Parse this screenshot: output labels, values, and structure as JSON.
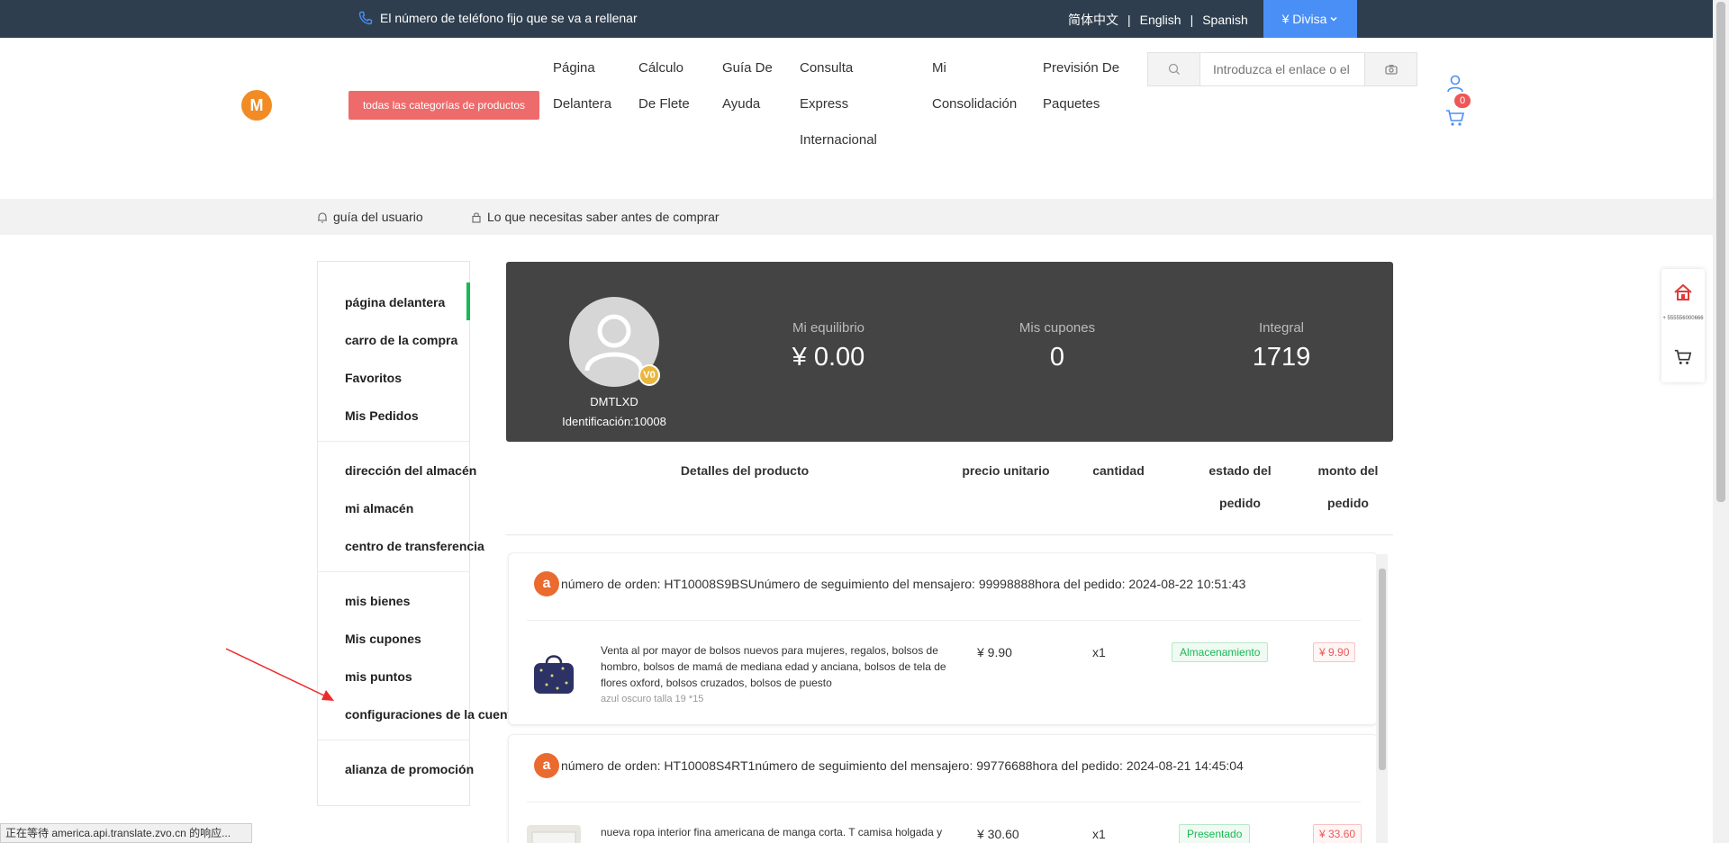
{
  "topbar": {
    "phone_text": "El número de teléfono fijo que se va a rellenar",
    "langs": [
      "简体中文",
      "English",
      "Spanish"
    ],
    "currency": "¥ Divisa"
  },
  "header": {
    "category_button": "todas las categorías de productos",
    "nav": [
      {
        "lines": [
          "Página",
          "Delantera"
        ]
      },
      {
        "lines": [
          "Cálculo",
          "De Flete"
        ]
      },
      {
        "lines": [
          "Guía De",
          "Ayuda"
        ]
      },
      {
        "lines": [
          "Consulta",
          "Express",
          "Internacional"
        ]
      },
      {
        "lines": [
          "Mi",
          "Consolidación"
        ]
      },
      {
        "lines": [
          "Previsión De",
          "Paquetes"
        ]
      }
    ],
    "search_placeholder": "Introduzca el enlace o el",
    "cart_count": "0"
  },
  "guide": {
    "user_guide": "guía del usuario",
    "before_buy": "Lo que necesitas saber antes de comprar"
  },
  "sidebar": {
    "items": [
      "página delantera",
      "carro de la compra",
      "Favoritos",
      "Mis Pedidos",
      "dirección del almacén",
      "mi almacén",
      "centro de transferencia",
      "mis bienes",
      "Mis cupones",
      "mis puntos",
      "configuraciones de la cuenta",
      "alianza de promoción"
    ]
  },
  "profile": {
    "level": "V0",
    "username": "DMTLXD",
    "id_text": "Identificación:10008",
    "balance_label": "Mi equilibrio",
    "balance_value": "¥ 0.00",
    "coupons_label": "Mis cupones",
    "coupons_value": "0",
    "integral_label": "Integral",
    "integral_value": "1719"
  },
  "table": {
    "col_details": "Detalles del producto",
    "col_unit_price": "precio unitario",
    "col_quantity": "cantidad",
    "col_status": [
      "estado del",
      "pedido"
    ],
    "col_amount": [
      "monto del",
      "pedido"
    ]
  },
  "orders": [
    {
      "header": "número de orden: HT10008S9BSUnúmero de seguimiento del mensajero: 99998888hora del pedido: 2024-08-22 10:51:43",
      "title": "Venta al por mayor de bolsos nuevos para mujeres, regalos, bolsos de hombro, bolsos de mamá de mediana edad y anciana, bolsos de tela de flores oxford, bolsos cruzados, bolsos de puesto",
      "sku": "azul oscuro talla 19 *15",
      "price": "¥ 9.90",
      "qty": "x1",
      "status": "Almacenamiento",
      "amount": "¥ 9.90"
    },
    {
      "header": "número de orden: HT10008S4RT1número de seguimiento del mensajero: 99776688hora del pedido: 2024-08-21 14:45:04",
      "title": "nueva ropa interior fina americana de manga corta. T camisa holgada y",
      "sku": "",
      "price": "¥ 30.60",
      "qty": "x1",
      "status": "Presentado",
      "amount": "¥ 33.60"
    }
  ],
  "float_panel": {
    "mini_text": "+ 555556000666"
  },
  "statusbar": "正在等待 america.api.translate.zvo.cn 的响应...",
  "colors": {
    "topbar": "#2e3e4e",
    "currency": "#4a8ff5",
    "category_button": "#ee6b6b",
    "active_green": "#19b955",
    "profile_bg": "#444444"
  }
}
